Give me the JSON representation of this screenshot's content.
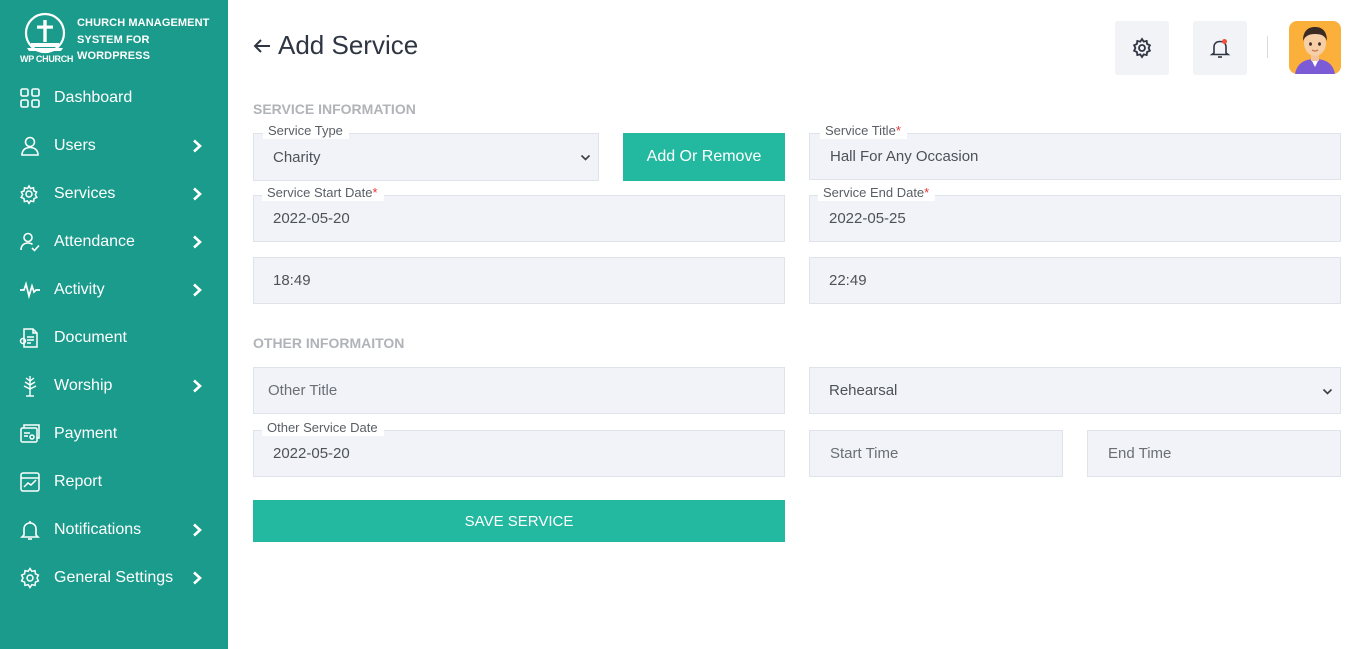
{
  "brand": {
    "logo_text": "WP CHURCH",
    "title": "CHURCH MANAGEMENT SYSTEM FOR WORDPRESS"
  },
  "sidebar": {
    "items": [
      {
        "label": "Dashboard",
        "icon": "dashboard-icon",
        "has_submenu": false
      },
      {
        "label": "Users",
        "icon": "user-icon",
        "has_submenu": true
      },
      {
        "label": "Services",
        "icon": "services-icon",
        "has_submenu": true
      },
      {
        "label": "Attendance",
        "icon": "attendance-icon",
        "has_submenu": true
      },
      {
        "label": "Activity",
        "icon": "activity-icon",
        "has_submenu": true
      },
      {
        "label": "Document",
        "icon": "document-icon",
        "has_submenu": false
      },
      {
        "label": "Worship",
        "icon": "worship-icon",
        "has_submenu": true
      },
      {
        "label": "Payment",
        "icon": "payment-icon",
        "has_submenu": false
      },
      {
        "label": "Report",
        "icon": "report-icon",
        "has_submenu": false
      },
      {
        "label": "Notifications",
        "icon": "bell-icon",
        "has_submenu": true
      },
      {
        "label": "General Settings",
        "icon": "gear-icon",
        "has_submenu": true
      }
    ]
  },
  "header": {
    "title": "Add Service",
    "settings_icon": "gear-icon",
    "notification_icon": "bell-icon",
    "avatar_icon": "user-avatar"
  },
  "service_info": {
    "heading": "SERVICE INFORMATION",
    "service_type_label": "Service Type",
    "service_type_value": "Charity",
    "add_remove_button": "Add Or Remove",
    "service_title_label": "Service Title",
    "service_title_value": "Hall For Any Occasion",
    "start_date_label": "Service Start Date",
    "start_date_value": "2022-05-20",
    "end_date_label": "Service End Date",
    "end_date_value": "2022-05-25",
    "start_time_value": "18:49",
    "end_time_value": "22:49",
    "required_mark": "*"
  },
  "other_info": {
    "heading": "OTHER INFORMAITON",
    "other_title_placeholder": "Other Title",
    "other_type_value": "Rehearsal",
    "other_date_label": "Other Service Date",
    "other_date_value": "2022-05-20",
    "start_time_placeholder": "Start Time",
    "end_time_placeholder": "End Time"
  },
  "save_button": "SAVE SERVICE",
  "colors": {
    "sidebar_bg": "#1a9b8c",
    "accent": "#22b9a0",
    "field_bg": "#f1f3f8",
    "required": "#e53935",
    "notification_dot": "#f0513a"
  }
}
